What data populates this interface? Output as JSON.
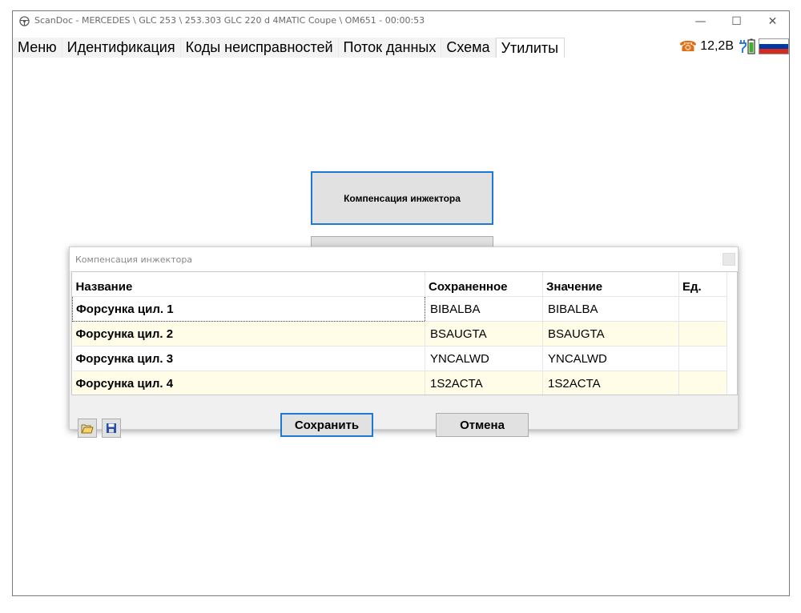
{
  "window": {
    "title": "ScanDoc - MERCEDES \\ GLC 253 \\ 253.303 GLC 220 d 4MATIC Coupe \\ OM651 - 00:00:53",
    "minimize": "—",
    "maximize": "☐",
    "close": "✕"
  },
  "tabs": [
    "Меню",
    "Идентификация",
    "Коды неисправностей",
    "Поток данных",
    "Схема",
    "Утилиты"
  ],
  "status": {
    "voltage": "12,2В",
    "phone_icon": "phone-icon",
    "plug_icon": "plug-battery-icon",
    "flag_icon": "russia-flag-icon"
  },
  "main": {
    "injector_button": "Компенсация инжектора"
  },
  "dialog": {
    "title": "Компенсация инжектора",
    "columns": [
      "Название",
      "Сохраненное",
      "Значение",
      "Ед."
    ],
    "rows": [
      {
        "name": "Форсунка цил. 1",
        "saved": "BIBALBA",
        "value": "BIBALBA",
        "unit": ""
      },
      {
        "name": "Форсунка цил. 2",
        "saved": "BSAUGTA",
        "value": "BSAUGTA",
        "unit": ""
      },
      {
        "name": "Форсунка цил. 3",
        "saved": "YNCALWD",
        "value": "YNCALWD",
        "unit": ""
      },
      {
        "name": "Форсунка цил. 4",
        "saved": "1S2ACTA",
        "value": "1S2ACTA",
        "unit": ""
      }
    ],
    "save_button": "Сохранить",
    "cancel_button": "Отмена"
  },
  "colors": {
    "accent": "#1f78d1",
    "alt_row": "#fffde8",
    "phone": "#e06d10"
  }
}
